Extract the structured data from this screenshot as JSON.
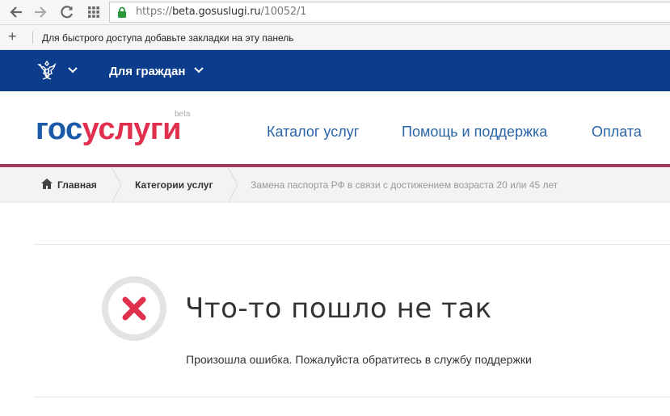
{
  "browser": {
    "url_prefix": "https://",
    "url_host": "beta.gosuslugi.ru",
    "url_path": "/10052/1",
    "bookmarks_hint": "Для быстрого доступа добавьте закладки на эту панель"
  },
  "topbar": {
    "audience_label": "Для граждан"
  },
  "logo": {
    "part1": "гос",
    "part2": "услуги",
    "beta": "beta"
  },
  "nav": {
    "catalog": "Каталог услуг",
    "help": "Помощь и поддержка",
    "payment": "Оплата"
  },
  "breadcrumb": {
    "home": "Главная",
    "categories": "Категории услуг",
    "current": "Замена паспорта РФ в связи с достижением возраста 20 или 45 лет"
  },
  "error": {
    "title": "Что-то пошло не так",
    "description": "Произошла ошибка. Пожалуйста обратитесь в службу поддержки"
  },
  "colors": {
    "topbar": "#0c3c8c",
    "logo_blue": "#1b5aa8",
    "logo_red": "#e0304d",
    "accent_line": "#a23b5d",
    "error_red": "#e0304d"
  }
}
